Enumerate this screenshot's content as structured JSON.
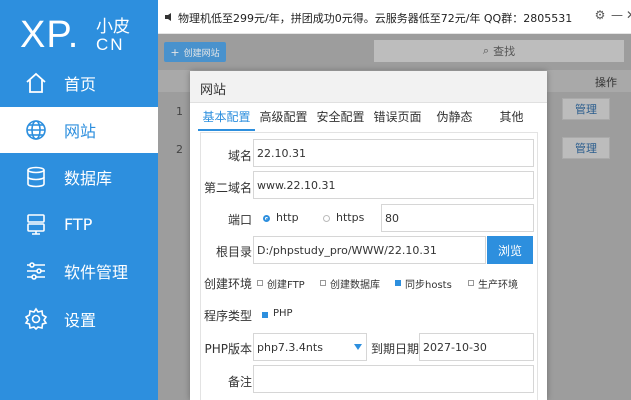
{
  "logo": {
    "main": "XP.",
    "top": "小皮",
    "bottom": "CN"
  },
  "sidebar": {
    "items": [
      {
        "label": "首页",
        "icon": "home-icon"
      },
      {
        "label": "网站",
        "icon": "globe-icon"
      },
      {
        "label": "数据库",
        "icon": "database-icon"
      },
      {
        "label": "FTP",
        "icon": "server-icon"
      },
      {
        "label": "软件管理",
        "icon": "sliders-icon"
      },
      {
        "label": "设置",
        "icon": "gear-icon"
      }
    ],
    "active_index": 1
  },
  "notice": {
    "text": "物理机低至299元/年，拼团成功0元得。云服务器低至72元/年 QQ群：2805531"
  },
  "window_controls": {
    "settings": "⚙",
    "minimize": "—",
    "close": "✕"
  },
  "toolbar": {
    "create_label": "创建网站",
    "search_placeholder": "查找"
  },
  "table": {
    "op_header": "操作",
    "rows": [
      {
        "num": "1",
        "action": "管理"
      },
      {
        "num": "2",
        "action": "管理"
      }
    ]
  },
  "modal": {
    "title": "网站",
    "tabs": [
      "基本配置",
      "高级配置",
      "安全配置",
      "错误页面",
      "伪静态",
      "其他"
    ],
    "active_tab": 0,
    "fields": {
      "domain_label": "域名",
      "domain_value": "22.10.31",
      "domain2_label": "第二域名",
      "domain2_value": "www.22.10.31",
      "port_label": "端口",
      "http_label": "http",
      "https_label": "https",
      "port_value": "80",
      "root_label": "根目录",
      "root_value": "D:/phpstudy_pro/WWW/22.10.31",
      "browse_label": "浏览",
      "env_label": "创建环境",
      "env_options": [
        {
          "label": "创建FTP",
          "checked": false
        },
        {
          "label": "创建数据库",
          "checked": false
        },
        {
          "label": "同步hosts",
          "checked": true
        },
        {
          "label": "生产环境",
          "checked": false
        }
      ],
      "type_label": "程序类型",
      "type_option": "PHP",
      "php_label": "PHP版本",
      "php_value": "php7.3.4nts",
      "expire_label": "到期日期",
      "expire_value": "2027-10-30",
      "note_label": "备注",
      "note_value": ""
    }
  },
  "colors": {
    "accent": "#2d8fde",
    "sidebar_bg": "#2d8fde",
    "overlay": "#9d9d9d"
  }
}
